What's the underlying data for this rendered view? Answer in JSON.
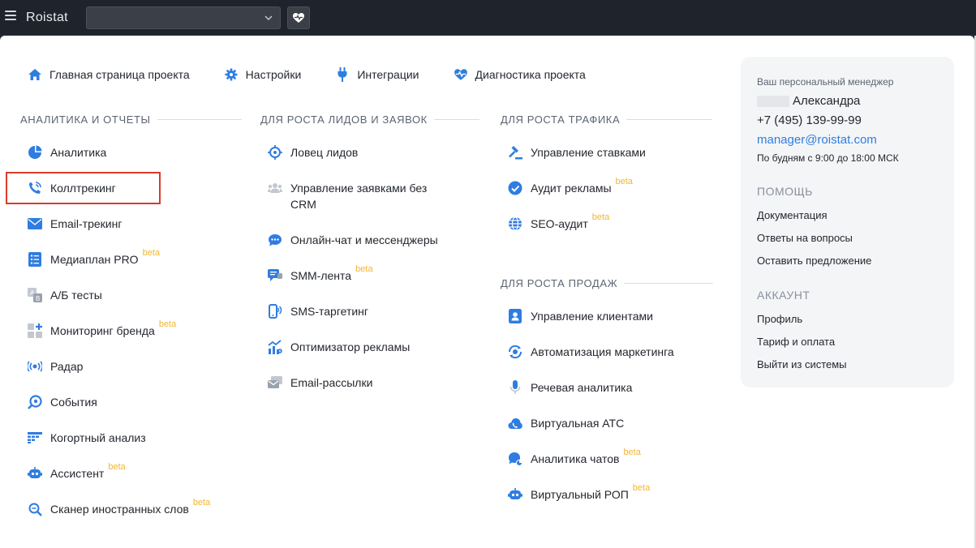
{
  "topbar": {
    "logo": "Roistat"
  },
  "topnav": [
    {
      "label": "Главная страница проекта",
      "icon": "home-icon"
    },
    {
      "label": "Настройки",
      "icon": "gear-icon"
    },
    {
      "label": "Интеграции",
      "icon": "plug-icon"
    },
    {
      "label": "Диагностика проекта",
      "icon": "heart-pulse-icon"
    }
  ],
  "columns": {
    "analytics": {
      "title": "АНАЛИТИКА И ОТЧЕТЫ",
      "items": [
        {
          "label": "Аналитика",
          "beta": ""
        },
        {
          "label": "Коллтрекинг",
          "beta": ""
        },
        {
          "label": "Email-трекинг",
          "beta": ""
        },
        {
          "label": "Медиаплан PRO",
          "beta": "beta"
        },
        {
          "label": "А/Б тесты",
          "beta": ""
        },
        {
          "label": "Мониторинг бренда",
          "beta": "beta"
        },
        {
          "label": "Радар",
          "beta": ""
        },
        {
          "label": "События",
          "beta": ""
        },
        {
          "label": "Когортный анализ",
          "beta": ""
        },
        {
          "label": "Ассистент",
          "beta": "beta"
        },
        {
          "label": "Сканер иностранных слов",
          "beta": "beta"
        }
      ]
    },
    "leads": {
      "title": "ДЛЯ РОСТА ЛИДОВ И ЗАЯВОК",
      "items": [
        {
          "label": "Ловец лидов",
          "beta": ""
        },
        {
          "label": "Управление заявками без",
          "label2": "CRM",
          "beta": ""
        },
        {
          "label": "Онлайн-чат и мессенджеры",
          "beta": ""
        },
        {
          "label": "SMM-лента",
          "beta": "beta"
        },
        {
          "label": "SMS-таргетинг",
          "beta": ""
        },
        {
          "label": "Оптимизатор рекламы",
          "beta": ""
        },
        {
          "label": "Email-рассылки",
          "beta": ""
        }
      ]
    },
    "traffic": {
      "title": "ДЛЯ РОСТА ТРАФИКА",
      "items": [
        {
          "label": "Управление ставками",
          "beta": ""
        },
        {
          "label": "Аудит рекламы",
          "beta": "beta"
        },
        {
          "label": "SEO-аудит",
          "beta": "beta"
        }
      ]
    },
    "sales": {
      "title": "ДЛЯ РОСТА ПРОДАЖ",
      "items": [
        {
          "label": "Управление клиентами",
          "beta": ""
        },
        {
          "label": "Автоматизация маркетинга",
          "beta": ""
        },
        {
          "label": "Речевая аналитика",
          "beta": ""
        },
        {
          "label": "Виртуальная АТС",
          "beta": ""
        },
        {
          "label": "Аналитика чатов",
          "beta": "beta"
        },
        {
          "label": "Виртуальный РОП",
          "beta": "beta"
        }
      ]
    }
  },
  "manager": {
    "label": "Ваш персональный менеджер",
    "name": "Александра",
    "phone": "+7 (495) 139-99-99",
    "email": "manager@roistat.com",
    "hours": "По будням с 9:00 до 18:00 МСК"
  },
  "help": {
    "title": "ПОМОЩЬ",
    "links": [
      "Документация",
      "Ответы на вопросы",
      "Оставить предложение"
    ]
  },
  "account": {
    "title": "АККАУНТ",
    "links": [
      "Профиль",
      "Тариф и оплата",
      "Выйти из системы"
    ]
  },
  "colors": {
    "accent": "#2f7de1",
    "beta": "#f2b632",
    "highlight": "#d93b2b",
    "topbar": "#1f232b"
  }
}
